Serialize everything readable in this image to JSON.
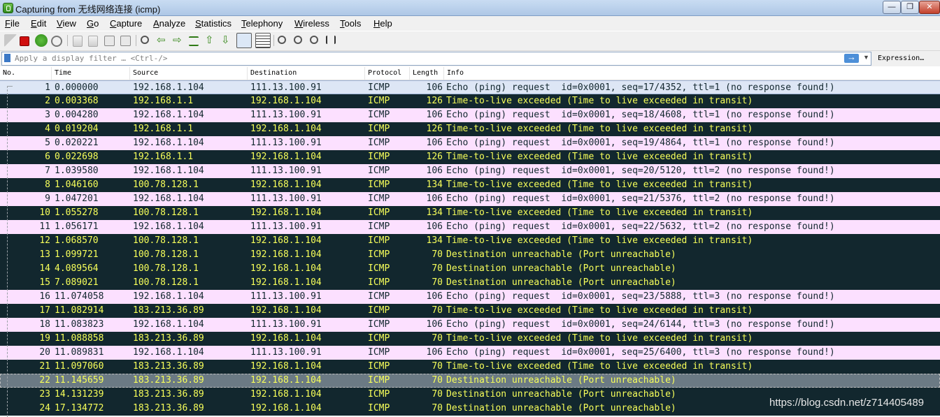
{
  "window": {
    "title": "Capturing from 无线网络连接 (icmp)",
    "minimize_label": "—",
    "restore_label": "❐",
    "close_label": "✕"
  },
  "menu": [
    "File",
    "Edit",
    "View",
    "Go",
    "Capture",
    "Analyze",
    "Statistics",
    "Telephony",
    "Wireless",
    "Tools",
    "Help"
  ],
  "toolbar": {
    "buttons": [
      "shark-fin-start-icon",
      "stop-capture-icon",
      "restart-capture-icon",
      "capture-options-icon",
      "open-file-icon",
      "save-file-icon",
      "close-file-icon",
      "reload-file-icon",
      "find-packet-icon",
      "go-back-icon",
      "go-forward-icon",
      "go-to-packet-icon",
      "go-to-first-icon",
      "go-to-last-icon",
      "autoscroll-icon",
      "colorize-icon",
      "zoom-in-icon",
      "zoom-out-icon",
      "normal-size-icon",
      "resize-columns-icon"
    ]
  },
  "filter": {
    "placeholder": "Apply a display filter … <Ctrl-/>",
    "expression_label": "Expression…"
  },
  "columns": [
    "No.",
    "Time",
    "Source",
    "Destination",
    "Protocol",
    "Length",
    "Info"
  ],
  "colors": {
    "request_bg": "#fce0ff",
    "request_fg": "#12272e",
    "error_bg": "#12272e",
    "error_fg": "#f7ff5a",
    "selected_bg": "#6b7a84",
    "first_row_bg": "#dde6f5"
  },
  "packets": [
    {
      "no": "1",
      "time": "0.000000",
      "src": "192.168.1.104",
      "dst": "111.13.100.91",
      "proto": "ICMP",
      "len": "106",
      "info": "Echo (ping) request  id=0x0001, seq=17/4352, ttl=1 (no response found!)",
      "kind": "first"
    },
    {
      "no": "2",
      "time": "0.003368",
      "src": "192.168.1.1",
      "dst": "192.168.1.104",
      "proto": "ICMP",
      "len": "126",
      "info": "Time-to-live exceeded (Time to live exceeded in transit)",
      "kind": "error"
    },
    {
      "no": "3",
      "time": "0.004280",
      "src": "192.168.1.104",
      "dst": "111.13.100.91",
      "proto": "ICMP",
      "len": "106",
      "info": "Echo (ping) request  id=0x0001, seq=18/4608, ttl=1 (no response found!)",
      "kind": "request"
    },
    {
      "no": "4",
      "time": "0.019204",
      "src": "192.168.1.1",
      "dst": "192.168.1.104",
      "proto": "ICMP",
      "len": "126",
      "info": "Time-to-live exceeded (Time to live exceeded in transit)",
      "kind": "error"
    },
    {
      "no": "5",
      "time": "0.020221",
      "src": "192.168.1.104",
      "dst": "111.13.100.91",
      "proto": "ICMP",
      "len": "106",
      "info": "Echo (ping) request  id=0x0001, seq=19/4864, ttl=1 (no response found!)",
      "kind": "request"
    },
    {
      "no": "6",
      "time": "0.022698",
      "src": "192.168.1.1",
      "dst": "192.168.1.104",
      "proto": "ICMP",
      "len": "126",
      "info": "Time-to-live exceeded (Time to live exceeded in transit)",
      "kind": "error"
    },
    {
      "no": "7",
      "time": "1.039580",
      "src": "192.168.1.104",
      "dst": "111.13.100.91",
      "proto": "ICMP",
      "len": "106",
      "info": "Echo (ping) request  id=0x0001, seq=20/5120, ttl=2 (no response found!)",
      "kind": "request"
    },
    {
      "no": "8",
      "time": "1.046160",
      "src": "100.78.128.1",
      "dst": "192.168.1.104",
      "proto": "ICMP",
      "len": "134",
      "info": "Time-to-live exceeded (Time to live exceeded in transit)",
      "kind": "error"
    },
    {
      "no": "9",
      "time": "1.047201",
      "src": "192.168.1.104",
      "dst": "111.13.100.91",
      "proto": "ICMP",
      "len": "106",
      "info": "Echo (ping) request  id=0x0001, seq=21/5376, ttl=2 (no response found!)",
      "kind": "request"
    },
    {
      "no": "10",
      "time": "1.055278",
      "src": "100.78.128.1",
      "dst": "192.168.1.104",
      "proto": "ICMP",
      "len": "134",
      "info": "Time-to-live exceeded (Time to live exceeded in transit)",
      "kind": "error"
    },
    {
      "no": "11",
      "time": "1.056171",
      "src": "192.168.1.104",
      "dst": "111.13.100.91",
      "proto": "ICMP",
      "len": "106",
      "info": "Echo (ping) request  id=0x0001, seq=22/5632, ttl=2 (no response found!)",
      "kind": "request"
    },
    {
      "no": "12",
      "time": "1.068570",
      "src": "100.78.128.1",
      "dst": "192.168.1.104",
      "proto": "ICMP",
      "len": "134",
      "info": "Time-to-live exceeded (Time to live exceeded in transit)",
      "kind": "error"
    },
    {
      "no": "13",
      "time": "1.099721",
      "src": "100.78.128.1",
      "dst": "192.168.1.104",
      "proto": "ICMP",
      "len": "70",
      "info": "Destination unreachable (Port unreachable)",
      "kind": "error"
    },
    {
      "no": "14",
      "time": "4.089564",
      "src": "100.78.128.1",
      "dst": "192.168.1.104",
      "proto": "ICMP",
      "len": "70",
      "info": "Destination unreachable (Port unreachable)",
      "kind": "error"
    },
    {
      "no": "15",
      "time": "7.089021",
      "src": "100.78.128.1",
      "dst": "192.168.1.104",
      "proto": "ICMP",
      "len": "70",
      "info": "Destination unreachable (Port unreachable)",
      "kind": "error"
    },
    {
      "no": "16",
      "time": "11.074058",
      "src": "192.168.1.104",
      "dst": "111.13.100.91",
      "proto": "ICMP",
      "len": "106",
      "info": "Echo (ping) request  id=0x0001, seq=23/5888, ttl=3 (no response found!)",
      "kind": "request"
    },
    {
      "no": "17",
      "time": "11.082914",
      "src": "183.213.36.89",
      "dst": "192.168.1.104",
      "proto": "ICMP",
      "len": "70",
      "info": "Time-to-live exceeded (Time to live exceeded in transit)",
      "kind": "error"
    },
    {
      "no": "18",
      "time": "11.083823",
      "src": "192.168.1.104",
      "dst": "111.13.100.91",
      "proto": "ICMP",
      "len": "106",
      "info": "Echo (ping) request  id=0x0001, seq=24/6144, ttl=3 (no response found!)",
      "kind": "request"
    },
    {
      "no": "19",
      "time": "11.088858",
      "src": "183.213.36.89",
      "dst": "192.168.1.104",
      "proto": "ICMP",
      "len": "70",
      "info": "Time-to-live exceeded (Time to live exceeded in transit)",
      "kind": "error"
    },
    {
      "no": "20",
      "time": "11.089831",
      "src": "192.168.1.104",
      "dst": "111.13.100.91",
      "proto": "ICMP",
      "len": "106",
      "info": "Echo (ping) request  id=0x0001, seq=25/6400, ttl=3 (no response found!)",
      "kind": "request"
    },
    {
      "no": "21",
      "time": "11.097060",
      "src": "183.213.36.89",
      "dst": "192.168.1.104",
      "proto": "ICMP",
      "len": "70",
      "info": "Time-to-live exceeded (Time to live exceeded in transit)",
      "kind": "error"
    },
    {
      "no": "22",
      "time": "11.145659",
      "src": "183.213.36.89",
      "dst": "192.168.1.104",
      "proto": "ICMP",
      "len": "70",
      "info": "Destination unreachable (Port unreachable)",
      "kind": "selected"
    },
    {
      "no": "23",
      "time": "14.131239",
      "src": "183.213.36.89",
      "dst": "192.168.1.104",
      "proto": "ICMP",
      "len": "70",
      "info": "Destination unreachable (Port unreachable)",
      "kind": "error"
    },
    {
      "no": "24",
      "time": "17.134772",
      "src": "183.213.36.89",
      "dst": "192.168.1.104",
      "proto": "ICMP",
      "len": "70",
      "info": "Destination unreachable (Port unreachable)",
      "kind": "error"
    }
  ],
  "watermark": "https://blog.csdn.net/z714405489"
}
